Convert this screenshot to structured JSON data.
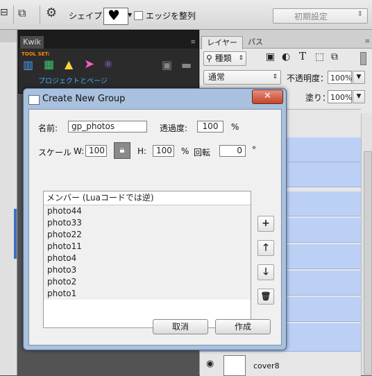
{
  "options_bar": {
    "shape_label": "シェイプ：",
    "align_edges_label": "エッジを整列",
    "preset_value": "初期設定"
  },
  "kwik_panel": {
    "tab_label": "Kwik",
    "toolset_label": "TOOL SET:",
    "project_label": "プロジェクトとページ"
  },
  "layers_panel": {
    "tabs": [
      "レイヤー",
      "パス"
    ],
    "filter_label": "種類",
    "blend_mode": "通常",
    "opacity_label": "不透明度：",
    "opacity_value": "100%",
    "fill_label": "塗り：",
    "fill_value": "100%",
    "bottom_layer_name": "cover8"
  },
  "dialog": {
    "title": "Create New Group",
    "close_symbol": "✕",
    "name_label": "名前:",
    "name_value": "gp_photos",
    "transparency_label": "透過度:",
    "transparency_value": "100",
    "percent": "%",
    "scale_label": "スケール",
    "w_label": "W:",
    "w_value": "100",
    "h_label": "H:",
    "h_value": "100",
    "rotation_label": "回転",
    "rotation_value": "0",
    "degree": "°",
    "members_header": "メンバー (Luaコードでは逆)",
    "members": [
      "photo44",
      "photo33",
      "photo22",
      "photo11",
      "photo4",
      "photo3",
      "photo2",
      "photo1"
    ],
    "cancel_label": "取消",
    "create_label": "作成"
  }
}
